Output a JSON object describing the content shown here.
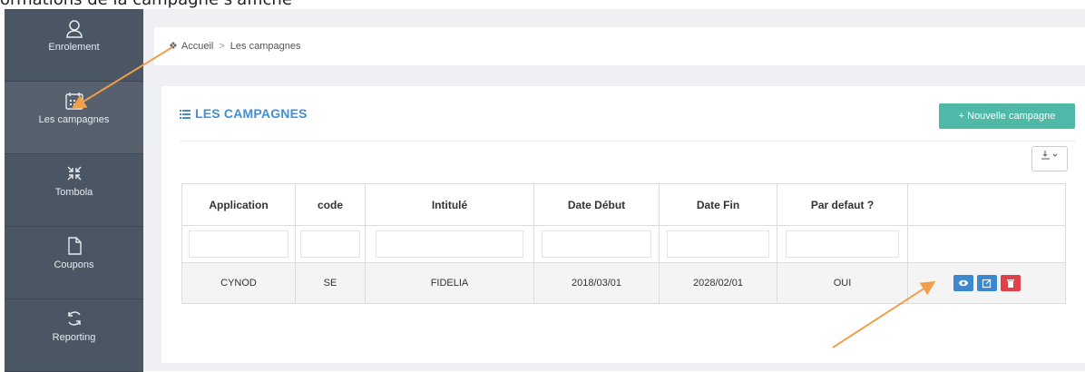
{
  "caption": "ormations de la campagne s'affiche",
  "sidebar": {
    "items": [
      {
        "label": "Enrolement",
        "icon": "user-icon"
      },
      {
        "label": "Les campagnes",
        "icon": "calendar-icon",
        "active": true
      },
      {
        "label": "Tombola",
        "icon": "compress-arrows-icon"
      },
      {
        "label": "Coupons",
        "icon": "file-icon"
      },
      {
        "label": "Reporting",
        "icon": "refresh-icon"
      }
    ]
  },
  "breadcrumb": {
    "home": "Accueil",
    "separator": ">",
    "current": "Les campagnes"
  },
  "panel": {
    "title": "LES CAMPAGNES",
    "new_button": "+ Nouvelle campagne",
    "export_icon": "export-icon"
  },
  "table": {
    "headers": [
      "Application",
      "code",
      "Intitulé",
      "Date Début",
      "Date Fin",
      "Par defaut ?",
      ""
    ],
    "rows": [
      {
        "application": "CYNOD",
        "code": "SE",
        "intitule": "FIDELIA",
        "date_debut": "2018/03/01",
        "date_fin": "2028/02/01",
        "par_defaut": "OUI"
      }
    ]
  },
  "colors": {
    "sidebar_bg": "#4a5663",
    "accent_title": "#3f8fd6",
    "new_button_bg": "#4fb8a6",
    "view_button": "#3d87cc",
    "edit_button": "#3d87cc",
    "delete_button": "#e0424b",
    "annotation_arrow": "#f0a04b"
  }
}
